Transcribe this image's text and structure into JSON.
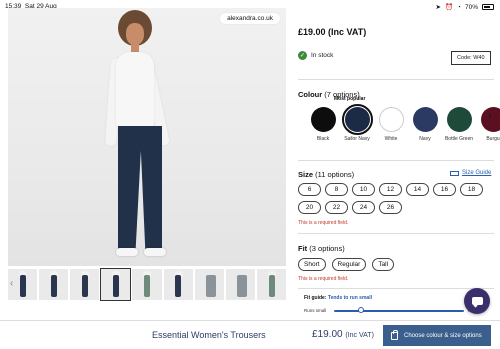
{
  "status_bar": {
    "time": "15:39",
    "date": "Sat 29 Aug",
    "battery": "70%"
  },
  "gallery": {
    "url": "alexandra.co.uk",
    "thumbnail_count": 9
  },
  "product": {
    "price": "£19.00 (Inc VAT)",
    "stock": "In stock",
    "code": "Code: W40"
  },
  "colour": {
    "title": "Colour",
    "options_text": "(7 options)",
    "popular_badge": "Most popular",
    "swatches": [
      {
        "name": "Black",
        "hex": "#0d0d0d"
      },
      {
        "name": "Sailor Navy",
        "hex": "#1c2b45"
      },
      {
        "name": "White",
        "hex": "#ffffff"
      },
      {
        "name": "Navy",
        "hex": "#2b3a63"
      },
      {
        "name": "Bottle Green",
        "hex": "#1f4a3a"
      },
      {
        "name": "Burgu",
        "hex": "#5a1020"
      }
    ],
    "selected": "Sailor Navy"
  },
  "size": {
    "title": "Size",
    "options_text": "(11 options)",
    "guide_label": "Size Guide",
    "options": [
      "6",
      "8",
      "10",
      "12",
      "14",
      "16",
      "18",
      "20",
      "22",
      "24",
      "26"
    ],
    "error": "This is a required field."
  },
  "fit": {
    "title": "Fit",
    "options_text": "(3 options)",
    "options": [
      "Short",
      "Regular",
      "Tall"
    ],
    "error": "This is a required field.",
    "guide_label": "Fit guide:",
    "guide_value": "Tends to run small",
    "slider_left": "Runs small",
    "slider_right": "Ru",
    "slider_level": 0.2
  },
  "bottom_bar": {
    "title": "Essential Women's Trousers",
    "price": "£19.00",
    "price_suffix": "(Inc VAT)",
    "cta": "Choose colour & size options"
  },
  "colors": {
    "accent": "#3a5f8c",
    "link": "#2a5db0",
    "error": "#c0392b",
    "chat": "#3b2f6b"
  }
}
